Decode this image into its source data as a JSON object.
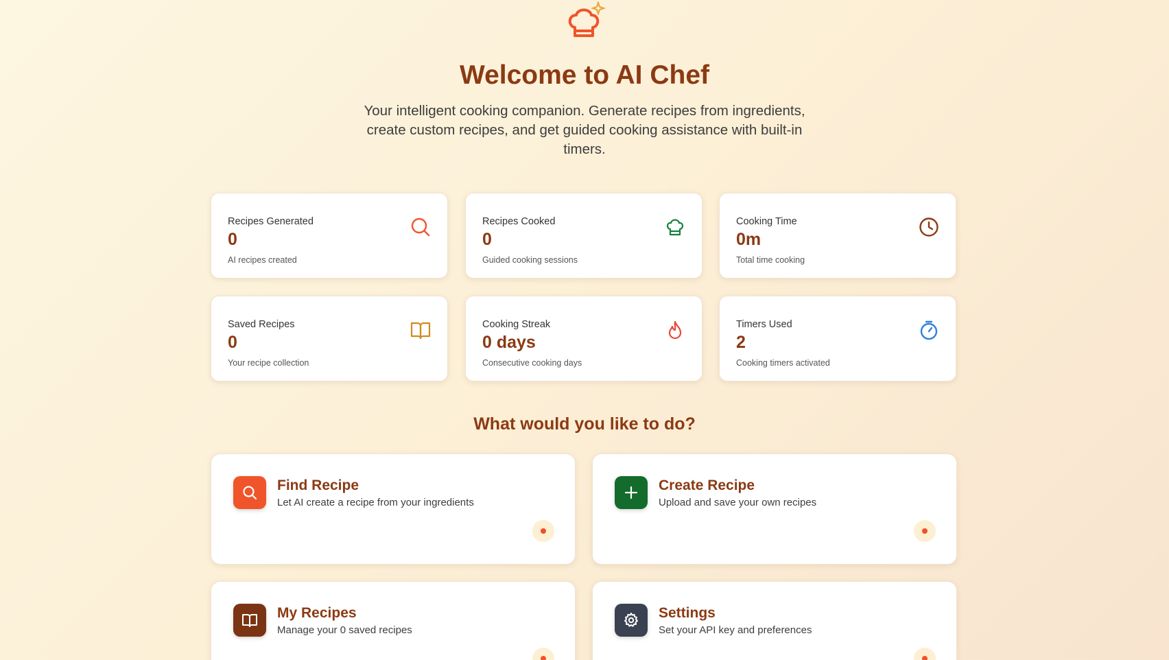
{
  "hero": {
    "title": "Welcome to AI Chef",
    "subtitle": "Your intelligent cooking companion. Generate recipes from ingredients, create custom recipes, and get guided cooking assistance with built-in timers.",
    "logo_icon": "chef-hat-sparkle-icon"
  },
  "stats": [
    {
      "label": "Recipes Generated",
      "value": "0",
      "desc": "AI recipes created",
      "icon": "search-icon",
      "color": "#f0542a"
    },
    {
      "label": "Recipes Cooked",
      "value": "0",
      "desc": "Guided cooking sessions",
      "icon": "chef-hat-icon",
      "color": "#15803d"
    },
    {
      "label": "Cooking Time",
      "value": "0m",
      "desc": "Total time cooking",
      "icon": "clock-icon",
      "color": "#8b3a13"
    },
    {
      "label": "Saved Recipes",
      "value": "0",
      "desc": "Your recipe collection",
      "icon": "book-icon",
      "color": "#d08a1e"
    },
    {
      "label": "Cooking Streak",
      "value": "0 days",
      "desc": "Consecutive cooking days",
      "icon": "flame-icon",
      "color": "#e5483b"
    },
    {
      "label": "Timers Used",
      "value": "2",
      "desc": "Cooking timers activated",
      "icon": "stopwatch-icon",
      "color": "#2f7fe0"
    }
  ],
  "section_title": "What would you like to do?",
  "actions": [
    {
      "title": "Find Recipe",
      "desc": "Let AI create a recipe from your ingredients",
      "icon": "search-icon",
      "color": "#f0542a"
    },
    {
      "title": "Create Recipe",
      "desc": "Upload and save your own recipes",
      "icon": "plus-icon",
      "color": "#136b2c"
    },
    {
      "title": "My Recipes",
      "desc": "Manage your 0 saved recipes",
      "icon": "book-icon",
      "color": "#7a3414"
    },
    {
      "title": "Settings",
      "desc": "Set your API key and preferences",
      "icon": "gear-icon",
      "color": "#3a4150"
    }
  ]
}
